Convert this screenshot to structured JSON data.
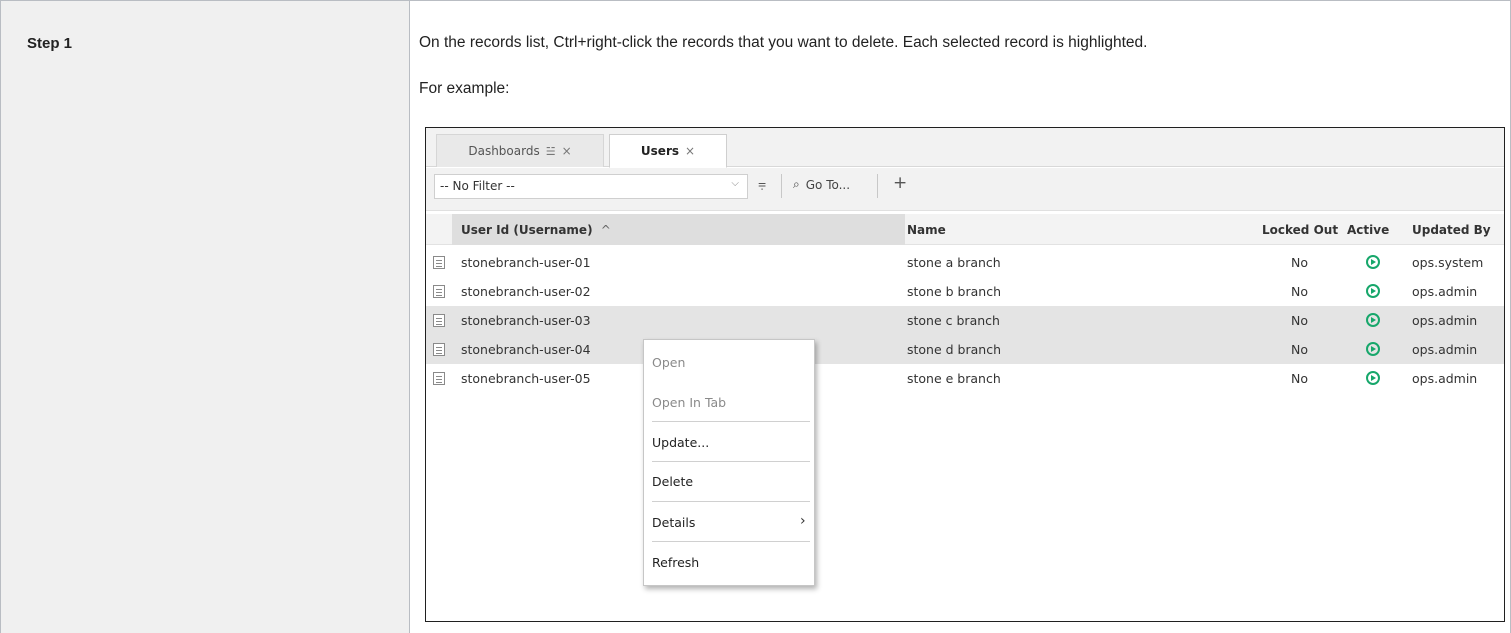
{
  "step_label": "Step 1",
  "instruction": "On the records list, Ctrl+right-click the records that you want to delete. Each selected record is highlighted.",
  "example_label": "For example:",
  "tabs": [
    {
      "label": "Dashboards",
      "pin_icon": "pin-icon",
      "close": "×"
    },
    {
      "label": "Users",
      "close": "×"
    }
  ],
  "toolbar": {
    "filter_value": "-- No Filter --",
    "goto_label": "Go To...",
    "add_label": "+"
  },
  "columns": [
    "User Id (Username)",
    "Name",
    "Locked Out",
    "Active",
    "Updated By"
  ],
  "sort_indicator": "^",
  "rows": [
    {
      "user_id": "stonebranch-user-01",
      "name": "stone a branch",
      "locked_out": "No",
      "updated_by": "ops.system",
      "selected": false
    },
    {
      "user_id": "stonebranch-user-02",
      "name": "stone b branch",
      "locked_out": "No",
      "updated_by": "ops.admin",
      "selected": false
    },
    {
      "user_id": "stonebranch-user-03",
      "name": "stone c branch",
      "locked_out": "No",
      "updated_by": "ops.admin",
      "selected": true
    },
    {
      "user_id": "stonebranch-user-04",
      "name": "stone d branch",
      "locked_out": "No",
      "updated_by": "ops.admin",
      "selected": true
    },
    {
      "user_id": "stonebranch-user-05",
      "name": "stone e branch",
      "locked_out": "No",
      "updated_by": "ops.admin",
      "selected": false
    }
  ],
  "context_menu": {
    "open": "Open",
    "open_in_tab": "Open In Tab",
    "update": "Update...",
    "delete": "Delete",
    "details": "Details",
    "refresh": "Refresh"
  },
  "colors": {
    "active_icon": "#17a76b",
    "selected_row": "#e4e4e4"
  }
}
